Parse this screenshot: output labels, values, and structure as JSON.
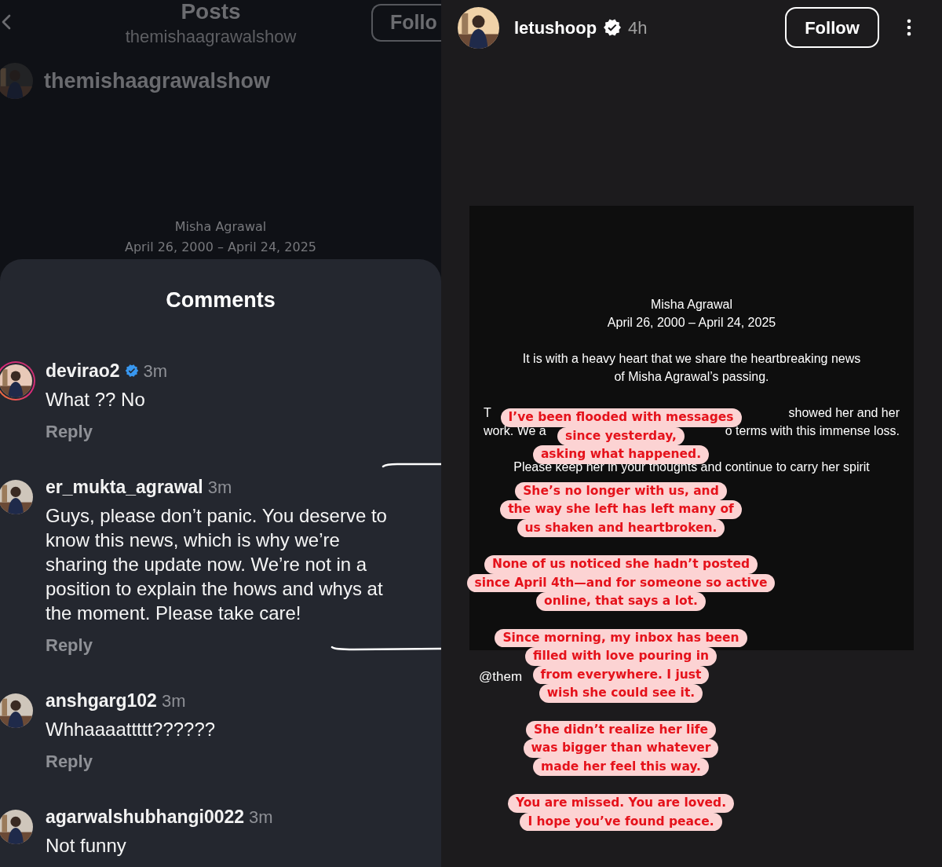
{
  "post_screen": {
    "header": {
      "title": "Posts",
      "subtitle": "themishaagrawalshow",
      "follow_button": "Follo"
    },
    "author": "themishaagrawalshow",
    "post_text": [
      "Misha Agrawal",
      "April 26, 2000 – April 24, 2025"
    ]
  },
  "comments_sheet": {
    "title": "Comments",
    "comments": [
      {
        "username": "devirao2",
        "verified": true,
        "story_ring": true,
        "time": "3m",
        "text": "What ?? No",
        "reply": "Reply"
      },
      {
        "username": "er_mukta_agrawal",
        "verified": false,
        "story_ring": false,
        "time": "3m",
        "text": "Guys, please don’t panic. You deserve to know this news, which is why we’re sharing the update now. We’re not in a position to explain the hows and whys at the moment. Please take care!",
        "reply": "Reply"
      },
      {
        "username": "anshgarg102",
        "verified": false,
        "story_ring": false,
        "time": "3m",
        "text": "Whhaaaattttt??????",
        "reply": "Reply"
      },
      {
        "username": "agarwalshubhangi0022",
        "verified": false,
        "story_ring": false,
        "time": "3m",
        "text": "Not funny"
      }
    ]
  },
  "story": {
    "username": "letushoop",
    "verified": true,
    "time": "4h",
    "follow_button": "Follow",
    "card": {
      "paragraphs": [
        [
          [
            "Misha Agrawal"
          ],
          [
            "April 26, 2000 – April 24, 2025"
          ]
        ],
        [
          [
            "It is with a heavy heart that we share the heartbreaking news"
          ],
          [
            "of Misha Agrawal’s passing."
          ]
        ],
        [
          [
            "T",
            "showed her and her"
          ],
          [
            "work. We a",
            "o terms with this immense loss."
          ]
        ],
        [
          [
            "Please keep her in your thoughts and continue to carry her spirit"
          ]
        ]
      ]
    },
    "mention": "@them",
    "stickers": [
      {
        "lines": [
          "I’ve been flooded with messages",
          "since yesterday,",
          "asking what happened."
        ]
      },
      {
        "lines": [
          "She’s no longer with us, and",
          "the way she left has left many of",
          "us shaken and heartbroken."
        ]
      },
      {
        "lines": [
          "None of us noticed she hadn’t posted",
          "since April 4th—and for someone so active",
          "online, that says a lot."
        ]
      },
      {
        "lines": [
          "Since morning, my inbox has been",
          "filled with love pouring in",
          "from everywhere. I just",
          "wish she could see it."
        ]
      },
      {
        "lines": [
          "She didn’t realize her life",
          "was bigger than whatever",
          "made her feel this way."
        ]
      },
      {
        "lines": [
          "You are missed. You are loved.",
          "I hope you’ve found peace."
        ]
      }
    ]
  }
}
